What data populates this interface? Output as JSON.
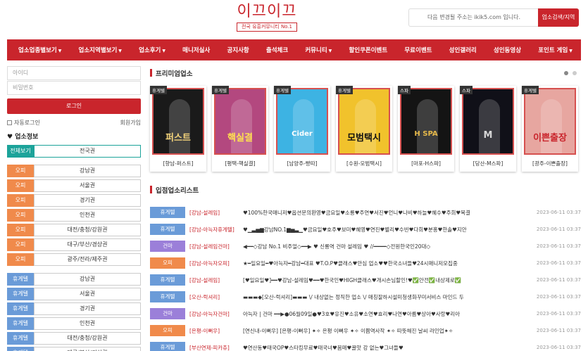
{
  "header": {
    "logo_title": "이끄이끄",
    "logo_sub": "전국 유흥커뮤니티 No.1",
    "notice": "다음 변경될 주소는 ikik5.com 입니다.",
    "notice_button": "업소검색/지역"
  },
  "nav": [
    {
      "label": "업소업종별보기",
      "caret": true
    },
    {
      "label": "업소지역별보기",
      "caret": true
    },
    {
      "label": "업소후기",
      "caret": true
    },
    {
      "label": "매니저실사",
      "caret": false
    },
    {
      "label": "공지사항",
      "caret": false
    },
    {
      "label": "출석체크",
      "caret": false
    },
    {
      "label": "커뮤니티",
      "caret": true
    },
    {
      "label": "할인쿠폰이벤트",
      "caret": false
    },
    {
      "label": "무료이벤트",
      "caret": false
    },
    {
      "label": "성인갤러리",
      "caret": false
    },
    {
      "label": "성인동영상",
      "caret": false
    },
    {
      "label": "포인트 게임",
      "caret": true
    }
  ],
  "login": {
    "id_placeholder": "아이디",
    "pw_placeholder": "비밀번호",
    "login_button": "로그인",
    "auto_login": "자동로그인",
    "join": "회원가입"
  },
  "business_info": {
    "title": "업소정보",
    "all_row": {
      "tag": "전체보기",
      "value": "전국권"
    },
    "group1": [
      {
        "tag": "오피",
        "value": "강남권"
      },
      {
        "tag": "오피",
        "value": "서울권"
      },
      {
        "tag": "오피",
        "value": "경기권"
      },
      {
        "tag": "오피",
        "value": "인천권"
      },
      {
        "tag": "오피",
        "value": "대전/충청/강원권"
      },
      {
        "tag": "오피",
        "value": "대구/부산/경상권"
      },
      {
        "tag": "오피",
        "value": "광주/전라/제주권"
      }
    ],
    "group2": [
      {
        "tag": "휴게텔",
        "value": "강남권"
      },
      {
        "tag": "휴게텔",
        "value": "서울권"
      },
      {
        "tag": "휴게텔",
        "value": "경기권"
      },
      {
        "tag": "휴게텔",
        "value": "인천권"
      },
      {
        "tag": "휴게텔",
        "value": "대전/충청/강원권"
      },
      {
        "tag": "휴게텔",
        "value": "대구/부산/경상권"
      }
    ]
  },
  "premium": {
    "title": "프리미엄업소",
    "cards": [
      {
        "badge": "휴게텔",
        "caption": "[향남-퍼스트]",
        "art": "퍼스트",
        "bg": "#1a1a1a",
        "fg": "#f2d27a"
      },
      {
        "badge": "휴게텔",
        "caption": "[평택-핵실결]",
        "art": "핵실결",
        "bg": "#b3487f",
        "fg": "#ffe14d"
      },
      {
        "badge": "휴게텔",
        "caption": "[남양주-빵따]",
        "art": "Cider",
        "bg": "#3db3e3",
        "fg": "#ffffff"
      },
      {
        "badge": "휴게텔",
        "caption": "[수원-모범택시]",
        "art": "모범택시",
        "bg": "#f1c22c",
        "fg": "#111111"
      },
      {
        "badge": "스파",
        "caption": "[마포-H스파]",
        "art": "H SPA",
        "bg": "#141414",
        "fg": "#e6b94a"
      },
      {
        "badge": "스파",
        "caption": "[당산-M스파]",
        "art": "M",
        "bg": "#101018",
        "fg": "#d6d6d6"
      },
      {
        "badge": "휴게텔",
        "caption": "[광주-이쁜출장]",
        "art": "이쁜출장",
        "bg": "#e7a6a0",
        "fg": "#c9252c"
      }
    ]
  },
  "list": {
    "title": "입점업소리스트",
    "rows": [
      {
        "tag": "휴게텔",
        "color": "blue",
        "area": "[강남-설레임]",
        "text": "♥100%한국매니저♥옵션문의환영♥금요일♥소룡♥주연♥서진♥언니♥나비♥하늘♥혜수♥주희♥목결",
        "date": "2023-06-11 03:37"
      },
      {
        "tag": "휴게텔",
        "color": "blue",
        "area": "[강남-아늑자휴게텔]",
        "text": "♥▁▃▅▆강남NO.1▆▅▃▁♥금요일♥호주♥보미♥혜영♥연진♥별리♥수빈♥다희♥분홍♥한솔♥지안",
        "date": "2023-06-11 03:37"
      },
      {
        "tag": "건마",
        "color": "purple",
        "area": "[강남-설레임건마]",
        "text": "◀━━◇강남 No.1 비주얼◇━━▶ ♥ 신룡역 건마 설레임 ♥ //━━━━◇전원한국인20대◇",
        "date": "2023-06-11 03:37"
      },
      {
        "tag": "오피",
        "color": "orange",
        "area": "[강남-아늑자오피]",
        "text": "★━일요일━♥아늑자━강남━대표 ♥T.O.P♥클래스♥안심 업소♥♥한국소녀들♥24시매니저모집중",
        "date": "2023-06-11 03:37"
      },
      {
        "tag": "휴게텔",
        "color": "blue",
        "area": "[강남-설레임]",
        "text": "[♥일요일♥]━━♥강남-설레임♥━━♥한국인♥HIGH클래스♥개시손님할인!♥✅안전✅내상제로✅",
        "date": "2023-06-11 03:37"
      },
      {
        "tag": "휴게텔",
        "color": "blue",
        "area": "[오산-럭셔리]",
        "text": "▬▬▬◆[오산-럭셔리]▬▬▬ \\/ 내상없는 정직한 업소 \\/ 매칭잘하시설미청생화꾸미서비스 마인드 두",
        "date": "2023-06-11 03:37"
      },
      {
        "tag": "건마",
        "color": "purple",
        "area": "[강남-아늑자건마]",
        "text": "아늑자 | 건마 ━━▶●06월09일●♥3호♥유진♥소유♥소연♥효리♥나연♥아름♥상아♥사랑♥리아",
        "date": "2023-06-11 03:37"
      },
      {
        "tag": "오피",
        "color": "orange",
        "area": "[은평-이뻐우]",
        "text": "[연신내-이뻐우] [은평-이뻐우] ✦✧ 은평 이뻐우 ✦✧ 이쁨역사작 ✦✧ 따뜻해진 날씨 라인업✦✧",
        "date": "2023-06-11 03:37"
      },
      {
        "tag": "휴게텔",
        "color": "blue",
        "area": "[부산연제-피카츄]",
        "text": "♥연산동♥태국OP♥스타킹무료♥태국녀♥몸매♥꿀맛 강 없는♥그녀들♥",
        "date": "2023-06-11 03:37"
      }
    ]
  }
}
